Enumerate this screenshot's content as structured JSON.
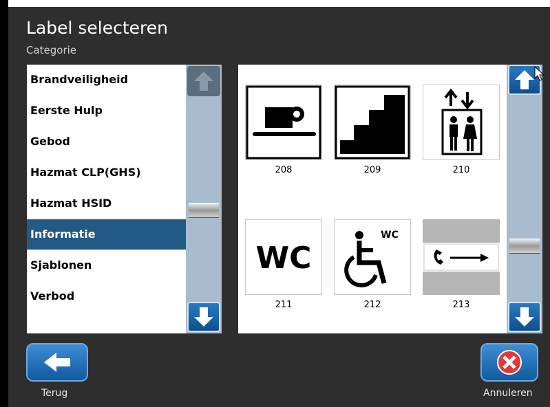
{
  "header": {
    "title": "Label selecteren",
    "subtitle": "Categorie"
  },
  "categories": [
    {
      "label": "Brandveiligheid",
      "selected": false
    },
    {
      "label": "Eerste Hulp",
      "selected": false
    },
    {
      "label": "Gebod",
      "selected": false
    },
    {
      "label": "Hazmat CLP(GHS)",
      "selected": false
    },
    {
      "label": "Hazmat HSID",
      "selected": false
    },
    {
      "label": "Informatie",
      "selected": true
    },
    {
      "label": "Sjablonen",
      "selected": false
    },
    {
      "label": "Verbod",
      "selected": false
    }
  ],
  "labels": [
    {
      "number": "208",
      "icon": "coffee-cup-icon"
    },
    {
      "number": "209",
      "icon": "stairs-icon"
    },
    {
      "number": "210",
      "icon": "elevator-icon"
    },
    {
      "number": "211",
      "icon": "wc-icon"
    },
    {
      "number": "212",
      "icon": "accessible-wc-icon"
    },
    {
      "number": "213",
      "icon": "phone-arrow-icon"
    }
  ],
  "footer": {
    "back_label": "Terug",
    "cancel_label": "Annuleren"
  },
  "colors": {
    "background": "#2e2e2e",
    "selected": "#235a85",
    "scrollbar": "#a9bccd",
    "button": "#1f6fb5",
    "cancel": "#e03a3a"
  }
}
